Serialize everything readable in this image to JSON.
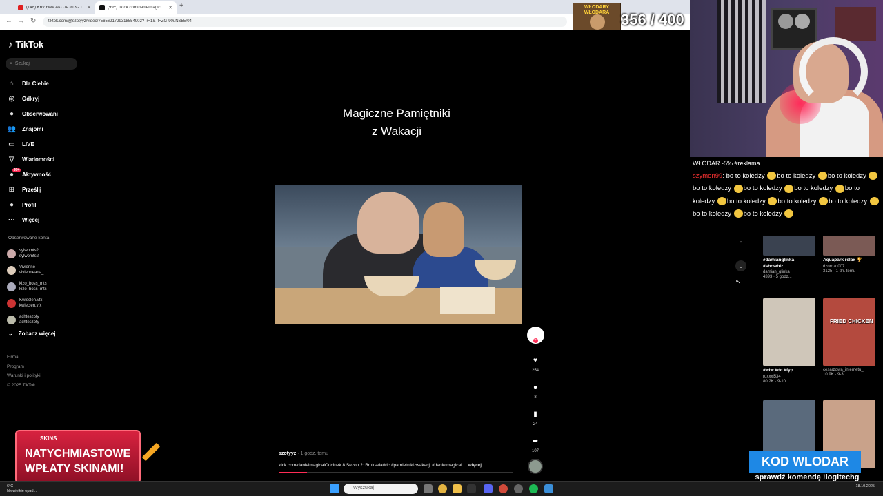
{
  "browser": {
    "tabs": [
      {
        "title": "(148) KRZYWA AKCJA #13 - TU..."
      },
      {
        "title": "(99+) tiktok.com/danielmagic..."
      }
    ],
    "url": "tiktok.com/@szotyyz/video/7565621729318554902?_r=1&_t=ZG-90uNS55r04"
  },
  "overlay": {
    "badge_text": "WŁODARY WŁODARA",
    "counter": "356 / 400",
    "chat_header": "WŁODAR -5% #reklama",
    "chat_user": "szymon99",
    "chat_phrase": "bo to koledzy",
    "promo_brand": "SKINS",
    "promo_line1": "NATYCHMIASTOWE",
    "promo_line2": "WPŁATY SKINAMI!",
    "kod": "KOD WLODAR",
    "kod_sub": "sprawdź komendę !logitechg"
  },
  "sidebar": {
    "logo": "TikTok",
    "search_placeholder": "Szukaj",
    "nav": [
      {
        "label": "Dla Ciebie",
        "icon": "home-icon",
        "glyph": "⌂"
      },
      {
        "label": "Odkryj",
        "icon": "compass-icon",
        "glyph": "◎"
      },
      {
        "label": "Obserwowani",
        "icon": "following-icon",
        "glyph": "●"
      },
      {
        "label": "Znajomi",
        "icon": "friends-icon",
        "glyph": "👥"
      },
      {
        "label": "LIVE",
        "icon": "live-icon",
        "glyph": "▭"
      },
      {
        "label": "Wiadomości",
        "icon": "messages-icon",
        "glyph": "▽"
      },
      {
        "label": "Aktywność",
        "icon": "activity-icon",
        "glyph": "●"
      },
      {
        "label": "Prześlij",
        "icon": "upload-icon",
        "glyph": "⊞"
      },
      {
        "label": "Profil",
        "icon": "profile-icon",
        "glyph": "●"
      },
      {
        "label": "Więcej",
        "icon": "more-icon",
        "glyph": "···"
      }
    ],
    "activity_badge": "99+",
    "following_title": "Obserwowane konta",
    "following": [
      {
        "name": "sylwomts2",
        "handle": "sylwomts2"
      },
      {
        "name": "Vivienne",
        "handle": "vivienneana_"
      },
      {
        "name": "kizo_boss_mts",
        "handle": "kizo_boss_mts"
      },
      {
        "name": "Kwieclen.vfx",
        "handle": "kwiecien.vfx"
      },
      {
        "name": "achteszoty",
        "handle": "achteszoty"
      }
    ],
    "see_more": "Zobacz więcej",
    "footer": [
      "Firma",
      "Program",
      "Warunki i polityki",
      "© 2025 TikTok"
    ]
  },
  "video": {
    "title_line1": "Magiczne Pamiętniki",
    "title_line2": "z Wakacji",
    "author": "szotyyz",
    "time": "· 1 godz. temu",
    "description": "kick.com/danielmagicalOdcinek 8 Sezon 2: Bruksela#dc #pamietnikizwakacji #danielmagical ...",
    "more": "więcej",
    "progress": 0.12,
    "likes": "254",
    "comments": "8",
    "saves": "24",
    "shares": "107"
  },
  "recommendations": [
    {
      "caption": "#damianglinka #showbiz",
      "user": "damian_glinka",
      "stats": "4393 · 5 godz...",
      "color": "#3a4250"
    },
    {
      "caption": "Aquapark relax 🏆",
      "user": "dzordzo007",
      "stats": "3125 · 1 dn. temu",
      "color": "#7b5a55"
    },
    {
      "caption": "#wiw #dc #fyp",
      "user": "roxxxl534",
      "stats": "80.2K · 9-10",
      "color": "#cfc6b9"
    },
    {
      "caption": "",
      "user": "cesarzowa_internetu_",
      "stats": "10.9K · 9-3",
      "color": "#b44a3e"
    },
    {
      "caption": "",
      "user": "",
      "stats": "",
      "color": "#5a6a7c"
    },
    {
      "caption": "",
      "user": "",
      "stats": "",
      "color": "#c9a28a"
    }
  ],
  "rec_overlay_text": "FRIED CHICKEN",
  "taskbar": {
    "weather": "6°C",
    "weather_desc": "Niewielkie opad...",
    "search": "Wyszukaj",
    "time": "",
    "date": "18.10.2025"
  }
}
